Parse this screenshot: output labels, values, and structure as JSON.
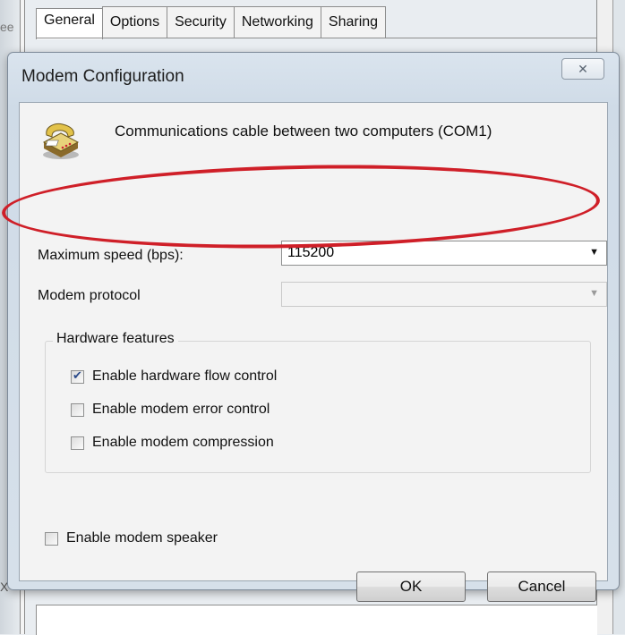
{
  "background": {
    "tabs": [
      "General",
      "Options",
      "Security",
      "Networking",
      "Sharing"
    ],
    "active_tab": "General",
    "edge_text_top": "ee",
    "edge_text_bottom": "X"
  },
  "dialog": {
    "title": "Modem Configuration",
    "close_glyph": "✕",
    "device_name": "Communications cable between two computers (COM1)",
    "max_speed_label": "Maximum speed (bps):",
    "max_speed_value": "115200",
    "protocol_label": "Modem protocol",
    "protocol_value": "",
    "hardware_group_title": "Hardware features",
    "hardware_options": [
      {
        "label": "Enable hardware flow control",
        "checked": true
      },
      {
        "label": "Enable modem error control",
        "checked": false
      },
      {
        "label": "Enable modem compression",
        "checked": false
      }
    ],
    "speaker_label": "Enable modem speaker",
    "speaker_checked": false,
    "ok_label": "OK",
    "cancel_label": "Cancel"
  },
  "annotation": {
    "color": "#cf1f28"
  },
  "icons": {
    "device": "phone-icon",
    "close": "close-icon",
    "dropdown": "chevron-down-icon"
  }
}
